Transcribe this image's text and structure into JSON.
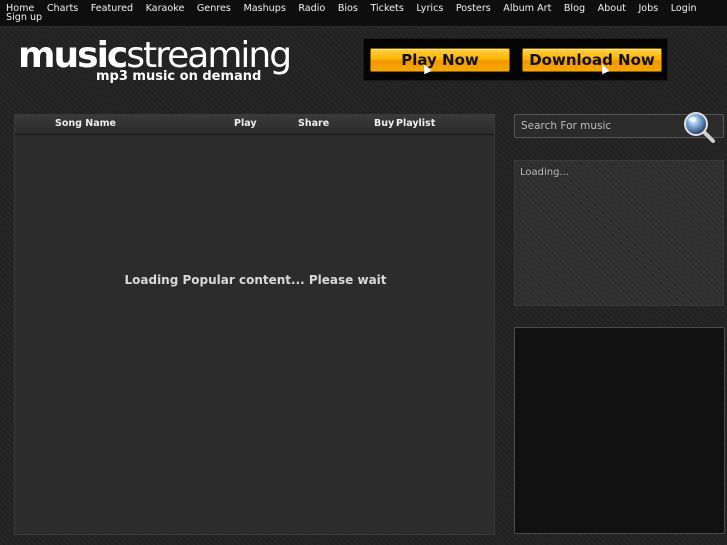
{
  "nav": {
    "items": [
      "Home",
      "Charts",
      "Featured",
      "Karaoke",
      "Genres",
      "Mashups",
      "Radio",
      "Bios",
      "Tickets",
      "Lyrics",
      "Posters",
      "Album Art",
      "Blog",
      "About",
      "Jobs",
      "Login"
    ],
    "second_row": [
      "Sign up"
    ]
  },
  "logo": {
    "bold": "music",
    "light": "streaming",
    "tagline": "mp3 music on demand"
  },
  "promo": {
    "play_label": "Play Now",
    "download_label": "Download Now"
  },
  "songs": {
    "columns": {
      "song_name": "Song Name",
      "play": "Play",
      "share": "Share",
      "buy": "Buy",
      "playlist": "Playlist"
    },
    "loading_text": "Loading Popular content... Please wait"
  },
  "search": {
    "placeholder": "Search For music"
  },
  "sidebar": {
    "loading_text": "Loading..."
  }
}
